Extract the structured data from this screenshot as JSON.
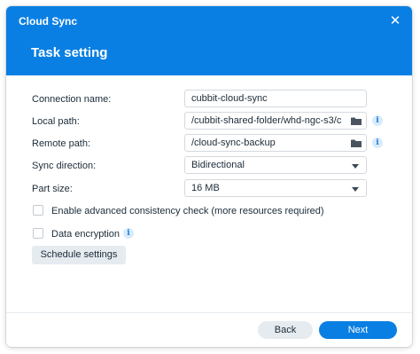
{
  "window": {
    "app_title": "Cloud Sync",
    "close_icon": "close-icon",
    "page_title": "Task setting"
  },
  "form": {
    "connection_name": {
      "label": "Connection name:",
      "value": "cubbit-cloud-sync"
    },
    "local_path": {
      "label": "Local path:",
      "value": "/cubbit-shared-folder/whd-ngc-s3/c",
      "icon": "folder-icon"
    },
    "remote_path": {
      "label": "Remote path:",
      "value": "/cloud-sync-backup",
      "icon": "folder-icon"
    },
    "sync_direction": {
      "label": "Sync direction:",
      "value": "Bidirectional"
    },
    "part_size": {
      "label": "Part size:",
      "value": "16 MB"
    },
    "advanced_consistency": {
      "label": "Enable advanced consistency check (more resources required)",
      "checked": false
    },
    "data_encryption": {
      "label": "Data encryption",
      "checked": false
    },
    "schedule_button": "Schedule settings"
  },
  "footer": {
    "back_label": "Back",
    "next_label": "Next"
  },
  "colors": {
    "accent": "#0a7fe3",
    "secondary_button": "#e6ebf0",
    "info_icon": "#1d7ed8"
  }
}
